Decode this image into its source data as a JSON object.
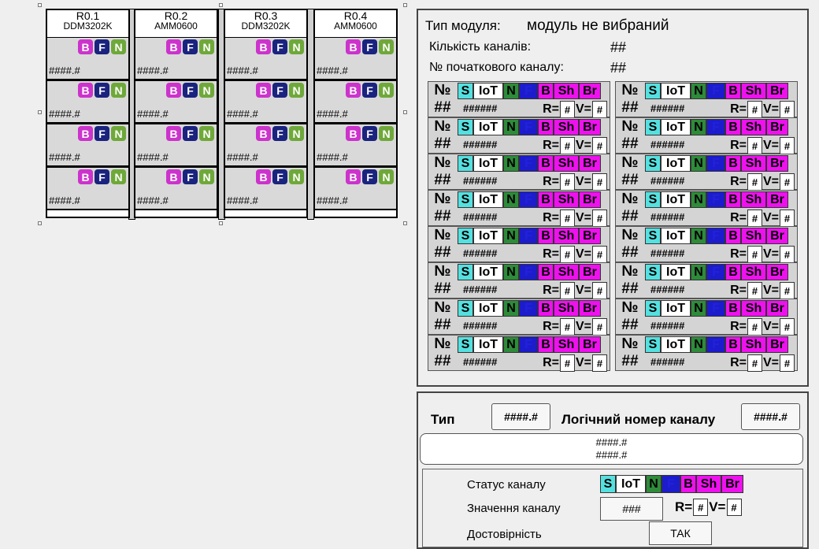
{
  "rack": {
    "modules": [
      {
        "rack": "R0.1",
        "model": "DDM3202K"
      },
      {
        "rack": "R0.2",
        "model": "AMM0600"
      },
      {
        "rack": "R0.3",
        "model": "DDM3202K"
      },
      {
        "rack": "R0.4",
        "model": "AMM0600"
      }
    ],
    "badges": [
      "B",
      "F",
      "N"
    ],
    "channel_value": "####.#"
  },
  "module_panel": {
    "type_label": "Тип модуля:",
    "type_value": "модуль не вибраний",
    "count_label": "Кількість каналів:",
    "count_value": "##",
    "start_label": "№ початкового каналу:",
    "start_value": "##",
    "cell_no": "№",
    "cell_num": "##",
    "cell_hash": "######",
    "flags": [
      "S",
      "IoT",
      "N",
      "F",
      "B",
      "Sh",
      "Br"
    ],
    "r_label": "R=",
    "v_label": "V=",
    "box_val": "#"
  },
  "channel_panel": {
    "type_label": "Тип",
    "type_value": "####.#",
    "logical_label": "Логічний номер каналу",
    "logical_value": "####.#",
    "desc_line1": "####.#",
    "desc_line2": "####.#",
    "status_label": "Статус каналу",
    "value_label": "Значення каналу",
    "value_field": "###",
    "valid_label": "Достовірність",
    "valid_value": "ТАК"
  },
  "colors": {
    "B": "#cc33cc",
    "F": "#1a237e",
    "N": "#6fa83a",
    "flag_magenta": "#ee11ee",
    "flag_cyan": "#55e0e0"
  }
}
